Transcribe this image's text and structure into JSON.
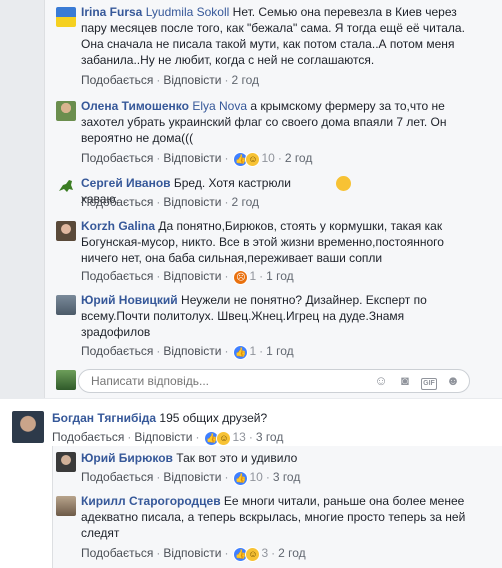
{
  "comments": [
    {
      "author": "Irina Fursa",
      "mention": "Lyudmila Sokoll",
      "text": " Нет. Семью она перевезла в Киев через пару месяцев после того, как \"бежала\" сама. Я тогда ещё её читала. Она сначала не писала такой мути, как потом стала..А потом меня забанила..Ну не любит, когда с ней не соглашаются.",
      "like": "Подобається",
      "reply": "Відповісти",
      "time": "2 год"
    },
    {
      "author": "Олена Тимошенко",
      "mention": "Elya Nova",
      "text": " а крымскому фермеру за то,что не захотел убрать украинский флаг со своего дома впаяли 7 лет. Он вероятно не дома(((",
      "like": "Подобається",
      "reply": "Відповісти",
      "count": "10",
      "time": "2 год"
    },
    {
      "author": "Сергей Иванов",
      "mention": "",
      "text": " Бред. Хотя кастрюли хаваю.",
      "like": "Подобається",
      "reply": "Відповісти",
      "time": "2 год"
    },
    {
      "author": "Korzh Galina",
      "mention": "",
      "text": " Да понятно,Бирюков, стоять у кормушки, такая как Богунская-мусор, никто. Все в этой жизни временно,постоянного ничего нет, она баба сильная,переживает ваши сопли",
      "like": "Подобається",
      "reply": "Відповісти",
      "count": "1",
      "time": "1 год"
    },
    {
      "author": "Юрий Новицкий",
      "mention": "",
      "text": " Неужели не понятно? Дизайнер. Експерт по всему.Почти политолух. Швец.Жнец.Игрец на дуде.Знамя зрадофилов",
      "like": "Подобається",
      "reply": "Відповісти",
      "count": "1",
      "time": "1 год"
    }
  ],
  "reply_placeholder": "Написати відповідь...",
  "thread": {
    "author": "Богдан Тягнибіда",
    "text": " 195 общих друзей?",
    "like": "Подобається",
    "reply": "Відповісти",
    "count": "13",
    "time": "3 год",
    "replies": [
      {
        "author": "Юрий Бирюков",
        "text": " Так вот это и удивило",
        "like": "Подобається",
        "reply": "Відповісти",
        "count": "10",
        "time": "3 год"
      },
      {
        "author": "Кирилл Старогородцев",
        "text": " Ее многи читали, раньше она более менее адекватно писала, а теперь вскрылась, многие просто теперь за ней следят",
        "like": "Подобається",
        "reply": "Відповісти",
        "count": "3",
        "time": "2 год"
      }
    ]
  },
  "colors": {
    "link": "#365899",
    "meta": "#90949c",
    "like": "#4080ff"
  }
}
